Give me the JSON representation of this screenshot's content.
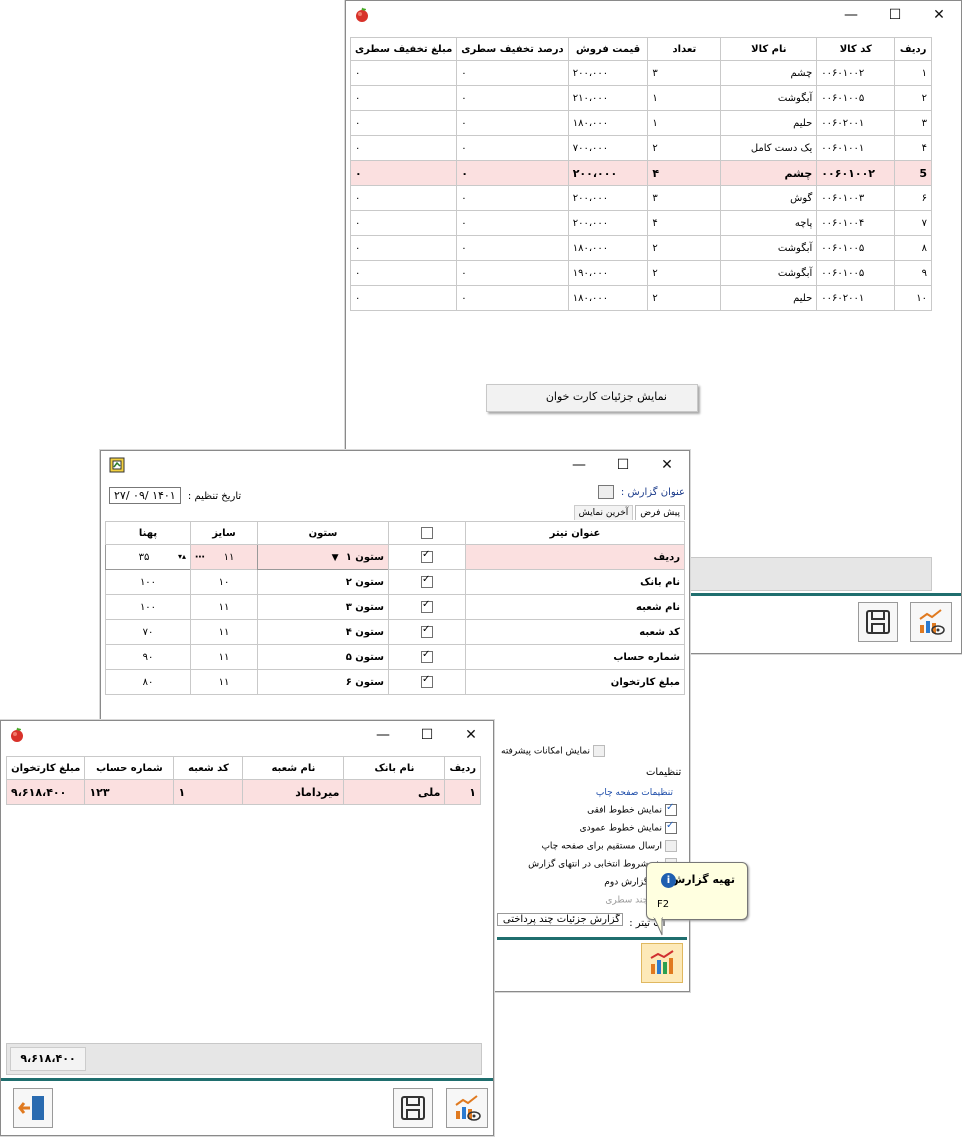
{
  "win1": {
    "columns": [
      "ردیف",
      "کد کالا",
      "نام کالا",
      "تعداد",
      "قیمت فروش",
      "درصد تخفیف سطری",
      "مبلغ تخفیف سطری"
    ],
    "rows": [
      [
        "۱",
        "۰۰۶۰۱۰۰۲",
        "چشم",
        "۳",
        "۲۰۰،۰۰۰",
        "۰",
        "۰"
      ],
      [
        "۲",
        "۰۰۶۰۱۰۰۵",
        "آبگوشت",
        "۱",
        "۲۱۰،۰۰۰",
        "۰",
        "۰"
      ],
      [
        "۳",
        "۰۰۶۰۲۰۰۱",
        "حلیم",
        "۱",
        "۱۸۰،۰۰۰",
        "۰",
        "۰"
      ],
      [
        "۴",
        "۰۰۶۰۱۰۰۱",
        "یک دست کامل",
        "۲",
        "۷۰۰،۰۰۰",
        "۰",
        "۰"
      ],
      [
        "5",
        "۰۰۶۰۱۰۰۲",
        "چشم",
        "۴",
        "۲۰۰،۰۰۰",
        "۰",
        "۰"
      ],
      [
        "۶",
        "۰۰۶۰۱۰۰۳",
        "گوش",
        "۳",
        "۲۰۰،۰۰۰",
        "۰",
        "۰"
      ],
      [
        "۷",
        "۰۰۶۰۱۰۰۴",
        "پاچه",
        "۴",
        "۲۰۰،۰۰۰",
        "۰",
        "۰"
      ],
      [
        "۸",
        "۰۰۶۰۱۰۰۵",
        "آبگوشت",
        "۲",
        "۱۸۰،۰۰۰",
        "۰",
        "۰"
      ],
      [
        "۹",
        "۰۰۶۰۱۰۰۵",
        "آبگوشت",
        "۲",
        "۱۹۰،۰۰۰",
        "۰",
        "۰"
      ],
      [
        "۱۰",
        "۰۰۶۰۲۰۰۱",
        "حلیم",
        "۲",
        "۱۸۰،۰۰۰",
        "۰",
        "۰"
      ]
    ],
    "context_menu_item": "نمایش جزئیات کارت خوان"
  },
  "win2": {
    "report_title_label": "عنوان گزارش :",
    "date_label": "تاریخ تنظیم :",
    "date_value": "۱۴۰۱ /۰۹ /۲۷",
    "tabs": [
      "پیش فرض",
      "آخرین نمایش"
    ],
    "columns": [
      "عنوان تیتر",
      "",
      "ستون",
      "سایز",
      "پهنا"
    ],
    "rows": [
      {
        "title": "ردیف",
        "column": "ستون ۱",
        "size": "۱۱",
        "width": "۳۵"
      },
      {
        "title": "نام بانک",
        "column": "ستون ۲",
        "size": "۱۰",
        "width": "۱۰۰"
      },
      {
        "title": "نام شعبه",
        "column": "ستون ۳",
        "size": "۱۱",
        "width": "۱۰۰"
      },
      {
        "title": "کد شعبه",
        "column": "ستون ۴",
        "size": "۱۱",
        "width": "۷۰"
      },
      {
        "title": "شماره حساب",
        "column": "ستون ۵",
        "size": "۱۱",
        "width": "۹۰"
      },
      {
        "title": "مبلغ کارتخوان",
        "column": "ستون ۶",
        "size": "۱۱",
        "width": "۸۰"
      }
    ],
    "advanced_label": "نمایش امکانات پیشرفته",
    "settings_tab": "تنظیمات",
    "print_group_title": "تنظیمات صفحه چاپ",
    "print_options": [
      {
        "label": "نمایش خطوط افقی",
        "checked": true
      },
      {
        "label": "نمایش خطوط عمودی",
        "checked": true
      },
      {
        "label": "ارسال مستقیم برای صفحه چاپ",
        "checked": false
      },
      {
        "label": "ش شروط انتخابی در انتهای گزارش",
        "checked": false
      },
      {
        "label": "ش گزارش دوم",
        "checked": false
      },
      {
        "label": "ش چند سطری",
        "checked": false
      }
    ],
    "title_field_label": "ات تیتر :",
    "title_field_value": "گزارش جزئیات چند پرداختی",
    "tooltip_title": "تهیه گزارش",
    "tooltip_shortcut": "F2"
  },
  "win3": {
    "columns": [
      "ردیف",
      "نام بانک",
      "نام شعبه",
      "کد شعبه",
      "شماره حساب",
      "مبلغ کارتخوان"
    ],
    "rows": [
      [
        "۱",
        "ملی",
        "میرداماد",
        "۱",
        "۱۲۳",
        "۹،۶۱۸،۴۰۰"
      ]
    ],
    "total": "۹،۶۱۸،۴۰۰"
  }
}
